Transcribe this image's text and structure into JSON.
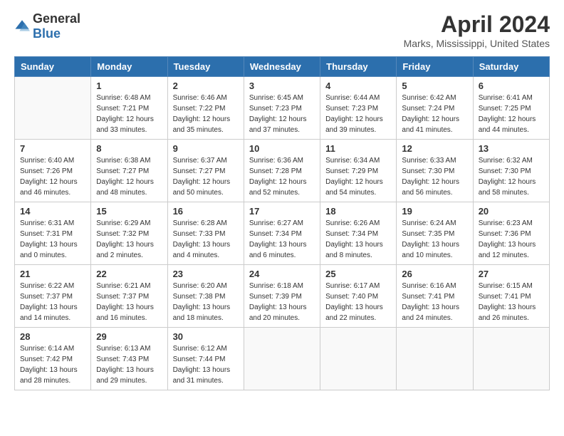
{
  "logo": {
    "general": "General",
    "blue": "Blue"
  },
  "title": "April 2024",
  "location": "Marks, Mississippi, United States",
  "days_header": [
    "Sunday",
    "Monday",
    "Tuesday",
    "Wednesday",
    "Thursday",
    "Friday",
    "Saturday"
  ],
  "weeks": [
    [
      {
        "day": "",
        "sunrise": "",
        "sunset": "",
        "daylight": ""
      },
      {
        "day": "1",
        "sunrise": "6:48 AM",
        "sunset": "7:21 PM",
        "daylight": "12 hours and 33 minutes."
      },
      {
        "day": "2",
        "sunrise": "6:46 AM",
        "sunset": "7:22 PM",
        "daylight": "12 hours and 35 minutes."
      },
      {
        "day": "3",
        "sunrise": "6:45 AM",
        "sunset": "7:23 PM",
        "daylight": "12 hours and 37 minutes."
      },
      {
        "day": "4",
        "sunrise": "6:44 AM",
        "sunset": "7:23 PM",
        "daylight": "12 hours and 39 minutes."
      },
      {
        "day": "5",
        "sunrise": "6:42 AM",
        "sunset": "7:24 PM",
        "daylight": "12 hours and 41 minutes."
      },
      {
        "day": "6",
        "sunrise": "6:41 AM",
        "sunset": "7:25 PM",
        "daylight": "12 hours and 44 minutes."
      }
    ],
    [
      {
        "day": "7",
        "sunrise": "6:40 AM",
        "sunset": "7:26 PM",
        "daylight": "12 hours and 46 minutes."
      },
      {
        "day": "8",
        "sunrise": "6:38 AM",
        "sunset": "7:27 PM",
        "daylight": "12 hours and 48 minutes."
      },
      {
        "day": "9",
        "sunrise": "6:37 AM",
        "sunset": "7:27 PM",
        "daylight": "12 hours and 50 minutes."
      },
      {
        "day": "10",
        "sunrise": "6:36 AM",
        "sunset": "7:28 PM",
        "daylight": "12 hours and 52 minutes."
      },
      {
        "day": "11",
        "sunrise": "6:34 AM",
        "sunset": "7:29 PM",
        "daylight": "12 hours and 54 minutes."
      },
      {
        "day": "12",
        "sunrise": "6:33 AM",
        "sunset": "7:30 PM",
        "daylight": "12 hours and 56 minutes."
      },
      {
        "day": "13",
        "sunrise": "6:32 AM",
        "sunset": "7:30 PM",
        "daylight": "12 hours and 58 minutes."
      }
    ],
    [
      {
        "day": "14",
        "sunrise": "6:31 AM",
        "sunset": "7:31 PM",
        "daylight": "13 hours and 0 minutes."
      },
      {
        "day": "15",
        "sunrise": "6:29 AM",
        "sunset": "7:32 PM",
        "daylight": "13 hours and 2 minutes."
      },
      {
        "day": "16",
        "sunrise": "6:28 AM",
        "sunset": "7:33 PM",
        "daylight": "13 hours and 4 minutes."
      },
      {
        "day": "17",
        "sunrise": "6:27 AM",
        "sunset": "7:34 PM",
        "daylight": "13 hours and 6 minutes."
      },
      {
        "day": "18",
        "sunrise": "6:26 AM",
        "sunset": "7:34 PM",
        "daylight": "13 hours and 8 minutes."
      },
      {
        "day": "19",
        "sunrise": "6:24 AM",
        "sunset": "7:35 PM",
        "daylight": "13 hours and 10 minutes."
      },
      {
        "day": "20",
        "sunrise": "6:23 AM",
        "sunset": "7:36 PM",
        "daylight": "13 hours and 12 minutes."
      }
    ],
    [
      {
        "day": "21",
        "sunrise": "6:22 AM",
        "sunset": "7:37 PM",
        "daylight": "13 hours and 14 minutes."
      },
      {
        "day": "22",
        "sunrise": "6:21 AM",
        "sunset": "7:37 PM",
        "daylight": "13 hours and 16 minutes."
      },
      {
        "day": "23",
        "sunrise": "6:20 AM",
        "sunset": "7:38 PM",
        "daylight": "13 hours and 18 minutes."
      },
      {
        "day": "24",
        "sunrise": "6:18 AM",
        "sunset": "7:39 PM",
        "daylight": "13 hours and 20 minutes."
      },
      {
        "day": "25",
        "sunrise": "6:17 AM",
        "sunset": "7:40 PM",
        "daylight": "13 hours and 22 minutes."
      },
      {
        "day": "26",
        "sunrise": "6:16 AM",
        "sunset": "7:41 PM",
        "daylight": "13 hours and 24 minutes."
      },
      {
        "day": "27",
        "sunrise": "6:15 AM",
        "sunset": "7:41 PM",
        "daylight": "13 hours and 26 minutes."
      }
    ],
    [
      {
        "day": "28",
        "sunrise": "6:14 AM",
        "sunset": "7:42 PM",
        "daylight": "13 hours and 28 minutes."
      },
      {
        "day": "29",
        "sunrise": "6:13 AM",
        "sunset": "7:43 PM",
        "daylight": "13 hours and 29 minutes."
      },
      {
        "day": "30",
        "sunrise": "6:12 AM",
        "sunset": "7:44 PM",
        "daylight": "13 hours and 31 minutes."
      },
      {
        "day": "",
        "sunrise": "",
        "sunset": "",
        "daylight": ""
      },
      {
        "day": "",
        "sunrise": "",
        "sunset": "",
        "daylight": ""
      },
      {
        "day": "",
        "sunrise": "",
        "sunset": "",
        "daylight": ""
      },
      {
        "day": "",
        "sunrise": "",
        "sunset": "",
        "daylight": ""
      }
    ]
  ],
  "labels": {
    "sunrise": "Sunrise: ",
    "sunset": "Sunset: ",
    "daylight": "Daylight: "
  }
}
